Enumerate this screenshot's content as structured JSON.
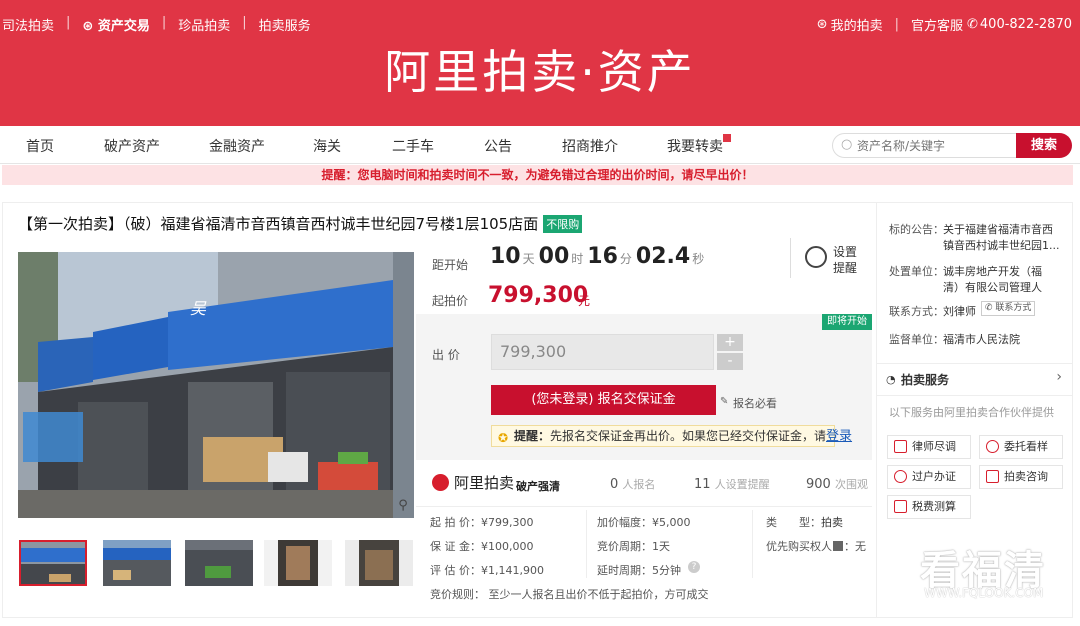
{
  "topbar": {
    "links": [
      "司法拍卖",
      "资产交易",
      "珍品拍卖",
      "拍卖服务"
    ],
    "my_auction": "我的拍卖",
    "service": "官方客服",
    "phone": "400-822-2870"
  },
  "brand": "阿里拍卖·资产",
  "nav": [
    "首页",
    "破产资产",
    "金融资产",
    "海关",
    "二手车",
    "公告",
    "招商推介",
    "我要转卖"
  ],
  "search": {
    "placeholder": "资产名称/关键字",
    "button": "搜索"
  },
  "notice": "提醒：您电脑时间和拍卖时间不一致，为避免错过合理的出价时间，请尽早出价！",
  "title": "【第一次拍卖】（破）福建省福清市音西镇音西村诚丰世纪园7号楼1层105店面",
  "title_tag": "不限购",
  "countdown": {
    "label": "距开始",
    "days": "10",
    "days_unit": "天",
    "hours": "00",
    "hours_unit": "时",
    "minutes": "16",
    "minutes_unit": "分",
    "seconds": "02.4",
    "seconds_unit": "秒"
  },
  "reminder": {
    "line1": "设置",
    "line2": "提醒"
  },
  "start_price": {
    "label": "起拍价",
    "value": "799,300",
    "unit": "元"
  },
  "status_badge": "即将开始",
  "bid": {
    "label": "出 价",
    "value": "799,300",
    "plus": "+",
    "minus": "-"
  },
  "register_button": "(您未登录) 报名交保证金",
  "must_read": "报名必看",
  "tip": {
    "prefix": "提醒：",
    "text": "先报名交保证金再出价。如果您已经交付保证金，请",
    "link": "登录"
  },
  "partner": {
    "logo": "阿里拍卖",
    "sub": "破产强清",
    "stats": [
      {
        "num": "0",
        "label": "人报名"
      },
      {
        "num": "11",
        "label": "人设置提醒"
      },
      {
        "num": "900",
        "label": "次围观"
      }
    ]
  },
  "details": {
    "col1": [
      "起 拍 价：¥799,300",
      "保 证 金：¥100,000",
      "评 估 价：¥1,141,900"
    ],
    "col2": [
      "加价幅度：¥5,000",
      "竞价周期：1天",
      "延时周期：5分钟"
    ],
    "col3_type_label": "类　　型：",
    "col3_type_value": "拍卖",
    "col3_priority_label": "优先购买权人",
    "col3_priority_value": "：无",
    "rule": "竞价规则：   至少一人报名且出价不低于起拍价，方可成交"
  },
  "side": {
    "notice_label": "标的公告：",
    "notice_value_1": "关于福建省福清市音西",
    "notice_value_2": "镇音西村诚丰世纪园1...",
    "dispose_label": "处置单位：",
    "dispose_value_1": "诚丰房地产开发（福",
    "dispose_value_2": "清）有限公司管理人",
    "contact_label": "联系方式：",
    "contact_value": "刘律师",
    "contact_btn": "联系方式",
    "supervise_label": "监督单位：",
    "supervise_value": "福清市人民法院",
    "service_title": "拍卖服务",
    "service_desc": "以下服务由阿里拍卖合作伙伴提供",
    "services": [
      "律师尽调",
      "委托看样",
      "过户办证",
      "拍卖咨询",
      "税费测算"
    ]
  },
  "watermark": {
    "main": "看福清",
    "sub": "WWW.FQLOOK.COM"
  },
  "colors": {
    "brand_red": "#e03545",
    "accent": "#c8102e",
    "green": "#1ba672"
  }
}
